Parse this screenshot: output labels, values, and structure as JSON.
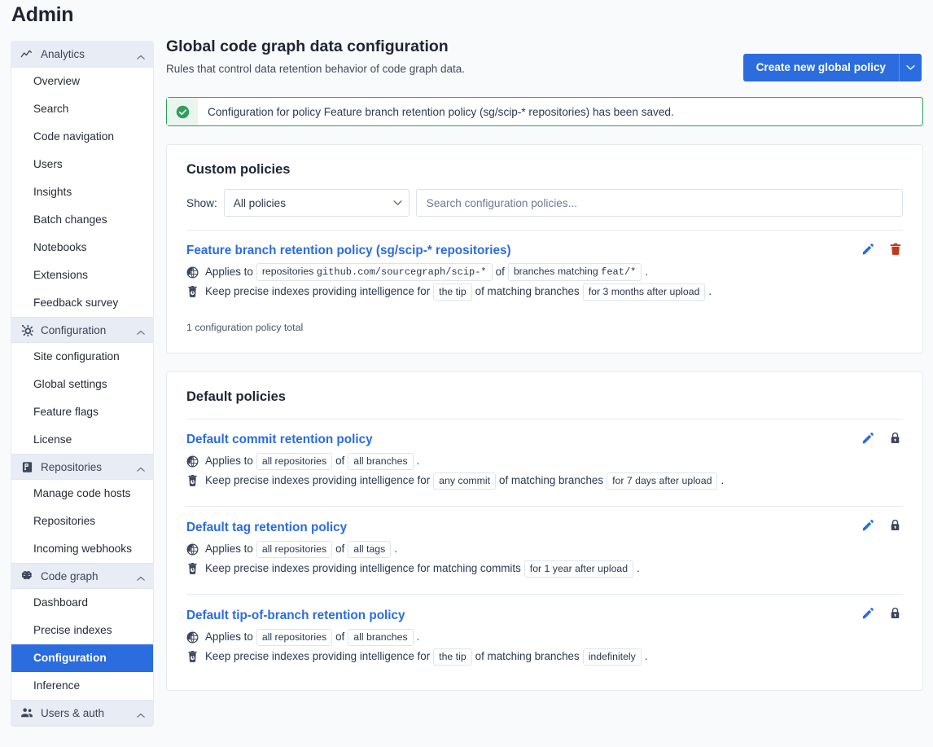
{
  "app": {
    "title": "Admin"
  },
  "sidebar": {
    "groups": [
      {
        "label": "Analytics",
        "icon": "line-chart-icon",
        "items": [
          {
            "label": "Overview"
          },
          {
            "label": "Search"
          },
          {
            "label": "Code navigation"
          },
          {
            "label": "Users"
          },
          {
            "label": "Insights"
          },
          {
            "label": "Batch changes"
          },
          {
            "label": "Notebooks"
          },
          {
            "label": "Extensions"
          },
          {
            "label": "Feedback survey"
          }
        ]
      },
      {
        "label": "Configuration",
        "icon": "cog-icon",
        "items": [
          {
            "label": "Site configuration"
          },
          {
            "label": "Global settings"
          },
          {
            "label": "Feature flags"
          },
          {
            "label": "License"
          }
        ]
      },
      {
        "label": "Repositories",
        "icon": "source-repository-icon",
        "items": [
          {
            "label": "Manage code hosts"
          },
          {
            "label": "Repositories"
          },
          {
            "label": "Incoming webhooks"
          }
        ]
      },
      {
        "label": "Code graph",
        "icon": "brain-icon",
        "items": [
          {
            "label": "Dashboard"
          },
          {
            "label": "Precise indexes"
          },
          {
            "label": "Configuration",
            "active": true
          },
          {
            "label": "Inference"
          }
        ]
      },
      {
        "label": "Users & auth",
        "icon": "account-multiple-icon",
        "items": []
      }
    ]
  },
  "header": {
    "title": "Global code graph data configuration",
    "subtitle": "Rules that control data retention behavior of code graph data.",
    "primary_button": "Create new global policy",
    "primary_button_caret_icon": "chevron-down-icon"
  },
  "alert": {
    "icon": "check-circle-icon",
    "message": "Configuration for policy Feature branch retention policy (sg/scip-* repositories) has been saved.",
    "border_color": "#2f9e5c",
    "icon_bg": "#e9f6ee"
  },
  "custom_policies": {
    "title": "Custom policies",
    "filter_label": "Show:",
    "filter_value": "All policies",
    "search_placeholder": "Search configuration policies...",
    "total_text": "1 configuration policy total",
    "policies": [
      {
        "name": "Feature branch retention policy (sg/scip-* repositories)",
        "applies_prefix": "Applies to",
        "applies_badge_text": "repositories ",
        "applies_badge_mono": "github.com/sourcegraph/scip-*",
        "applies_mid": "of",
        "applies_badge2_text": "branches matching ",
        "applies_badge2_mono": "feat/*",
        "applies_suffix": ".",
        "keep_prefix": "Keep precise indexes providing intelligence for",
        "keep_badge1": "the tip",
        "keep_mid": "of matching branches",
        "keep_badge2": "for 3 months after upload",
        "keep_suffix": ".",
        "actions": [
          {
            "icon": "pencil-icon",
            "color": "#2b6cde",
            "name": "edit-policy-button"
          },
          {
            "icon": "trash-icon",
            "color": "#c0391b",
            "name": "delete-policy-button"
          }
        ]
      }
    ]
  },
  "default_policies": {
    "title": "Default policies",
    "policies": [
      {
        "name": "Default commit retention policy",
        "applies_prefix": "Applies to",
        "applies_badge1": "all repositories",
        "applies_mid": "of",
        "applies_badge2": "all branches",
        "applies_suffix": ".",
        "keep_prefix": "Keep precise indexes providing intelligence for",
        "keep_badge1": "any commit",
        "keep_mid": "of matching branches",
        "keep_badge2": "for 7 days after upload",
        "keep_suffix": ".",
        "actions": [
          {
            "icon": "pencil-icon",
            "color": "#2b6cde",
            "name": "edit-policy-button"
          },
          {
            "icon": "lock-icon",
            "color": "#3d475c",
            "name": "locked-policy-icon"
          }
        ]
      },
      {
        "name": "Default tag retention policy",
        "applies_prefix": "Applies to",
        "applies_badge1": "all repositories",
        "applies_mid": "of",
        "applies_badge2": "all tags",
        "applies_suffix": ".",
        "keep_prefix": "Keep precise indexes providing intelligence for matching commits",
        "keep_badge1": "",
        "keep_mid": "",
        "keep_badge2": "for 1 year after upload",
        "keep_suffix": ".",
        "actions": [
          {
            "icon": "pencil-icon",
            "color": "#2b6cde",
            "name": "edit-policy-button"
          },
          {
            "icon": "lock-icon",
            "color": "#3d475c",
            "name": "locked-policy-icon"
          }
        ]
      },
      {
        "name": "Default tip-of-branch retention policy",
        "applies_prefix": "Applies to",
        "applies_badge1": "all repositories",
        "applies_mid": "of",
        "applies_badge2": "all branches",
        "applies_suffix": ".",
        "keep_prefix": "Keep precise indexes providing intelligence for",
        "keep_badge1": "the tip",
        "keep_mid": "of matching branches",
        "keep_badge2": "indefinitely",
        "keep_suffix": ".",
        "actions": [
          {
            "icon": "pencil-icon",
            "color": "#2b6cde",
            "name": "edit-policy-button"
          },
          {
            "icon": "lock-icon",
            "color": "#3d475c",
            "name": "locked-policy-icon"
          }
        ]
      }
    ]
  },
  "icons": {
    "globe": "earth-icon",
    "retention": "delete-clock-icon",
    "collapse": "chevron-up-icon"
  },
  "colors": {
    "accent": "#2b6cde",
    "success": "#2f9e5c",
    "danger": "#c0391b",
    "page_bg": "#f9fafb",
    "nav_group_bg": "#e8ecf5"
  }
}
